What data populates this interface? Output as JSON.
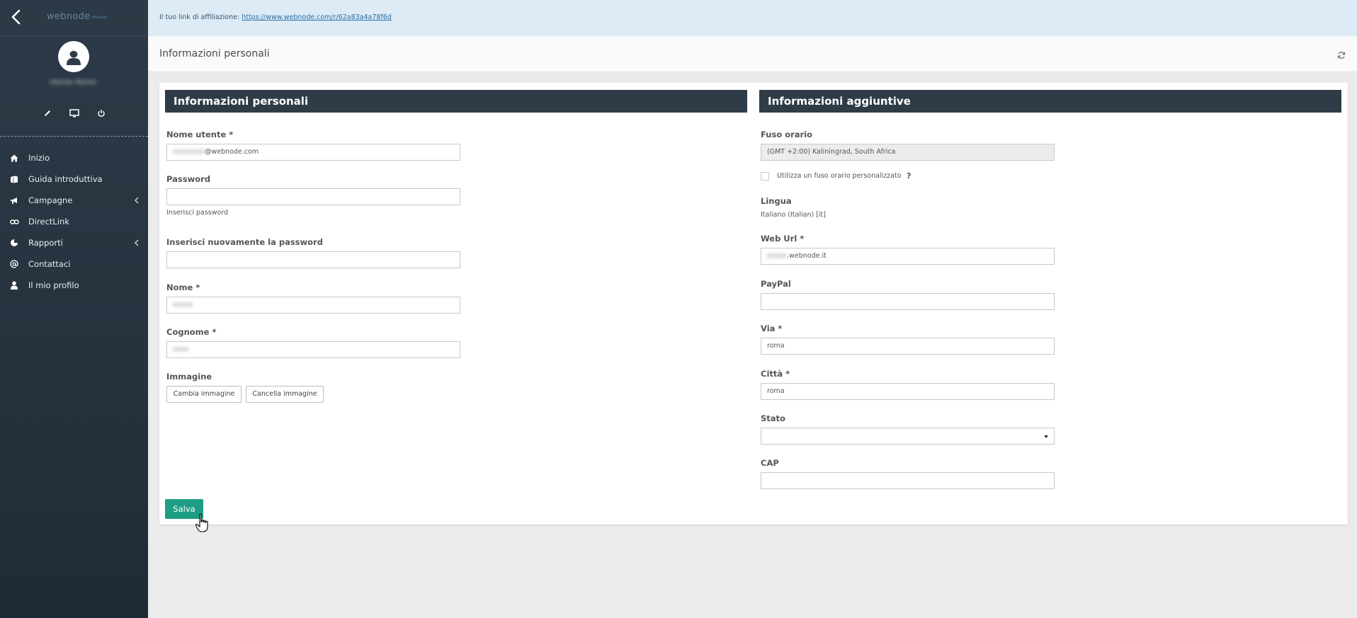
{
  "sidebar": {
    "brand": "webnode",
    "brand_sub": "affiliate",
    "user_name": "Utente Nome",
    "nav": [
      {
        "label": "Inizio",
        "icon": "home-icon"
      },
      {
        "label": "Guida introduttiva",
        "icon": "book-icon"
      },
      {
        "label": "Campagne",
        "icon": "bullhorn-icon",
        "has_children": true
      },
      {
        "label": "DirectLink",
        "icon": "link-icon"
      },
      {
        "label": "Rapporti",
        "icon": "pie-chart-icon",
        "has_children": true
      },
      {
        "label": "Contattaci",
        "icon": "at-icon"
      },
      {
        "label": "Il mio profilo",
        "icon": "user-icon"
      }
    ]
  },
  "topbar": {
    "affil_prefix": "Il tuo link di affiliazione:",
    "affil_url": "https://www.webnode.com/r/62a83a4a78f6d"
  },
  "page": {
    "title": "Informazioni personali"
  },
  "personal": {
    "header": "Informazioni personali",
    "username_label": "Nome utente *",
    "username_value": "@webnode.com",
    "username_hidden": "xxxxxxxx",
    "password_label": "Password",
    "password_hint": "Inserisci password",
    "password2_label": "Inserisci nuovamente la password",
    "name_label": "Nome *",
    "name_value": "xxxxx",
    "surname_label": "Cognome *",
    "surname_value": "xxxx",
    "image_label": "Immagine",
    "change_image": "Cambia immagine",
    "delete_image": "Cancella immagine"
  },
  "additional": {
    "header": "Informazioni aggiuntive",
    "timezone_label": "Fuso orario",
    "timezone_value": "(GMT +2:00) Kaliningrad, South Africa",
    "custom_tz_label": "Utilizza un fuso orario personalizzato",
    "custom_tz_help": "?",
    "language_label": "Lingua",
    "language_value": "Italiano (Italian) [it]",
    "weburl_label": "Web Url *",
    "weburl_hidden": "xxxxx",
    "weburl_value": ".webnode.it",
    "paypal_label": "PayPal",
    "street_label": "Via *",
    "street_value": "roma",
    "city_label": "Città *",
    "city_value": "roma",
    "state_label": "Stato",
    "state_value": "",
    "zip_label": "CAP"
  },
  "actions": {
    "save_label": "Salva"
  }
}
